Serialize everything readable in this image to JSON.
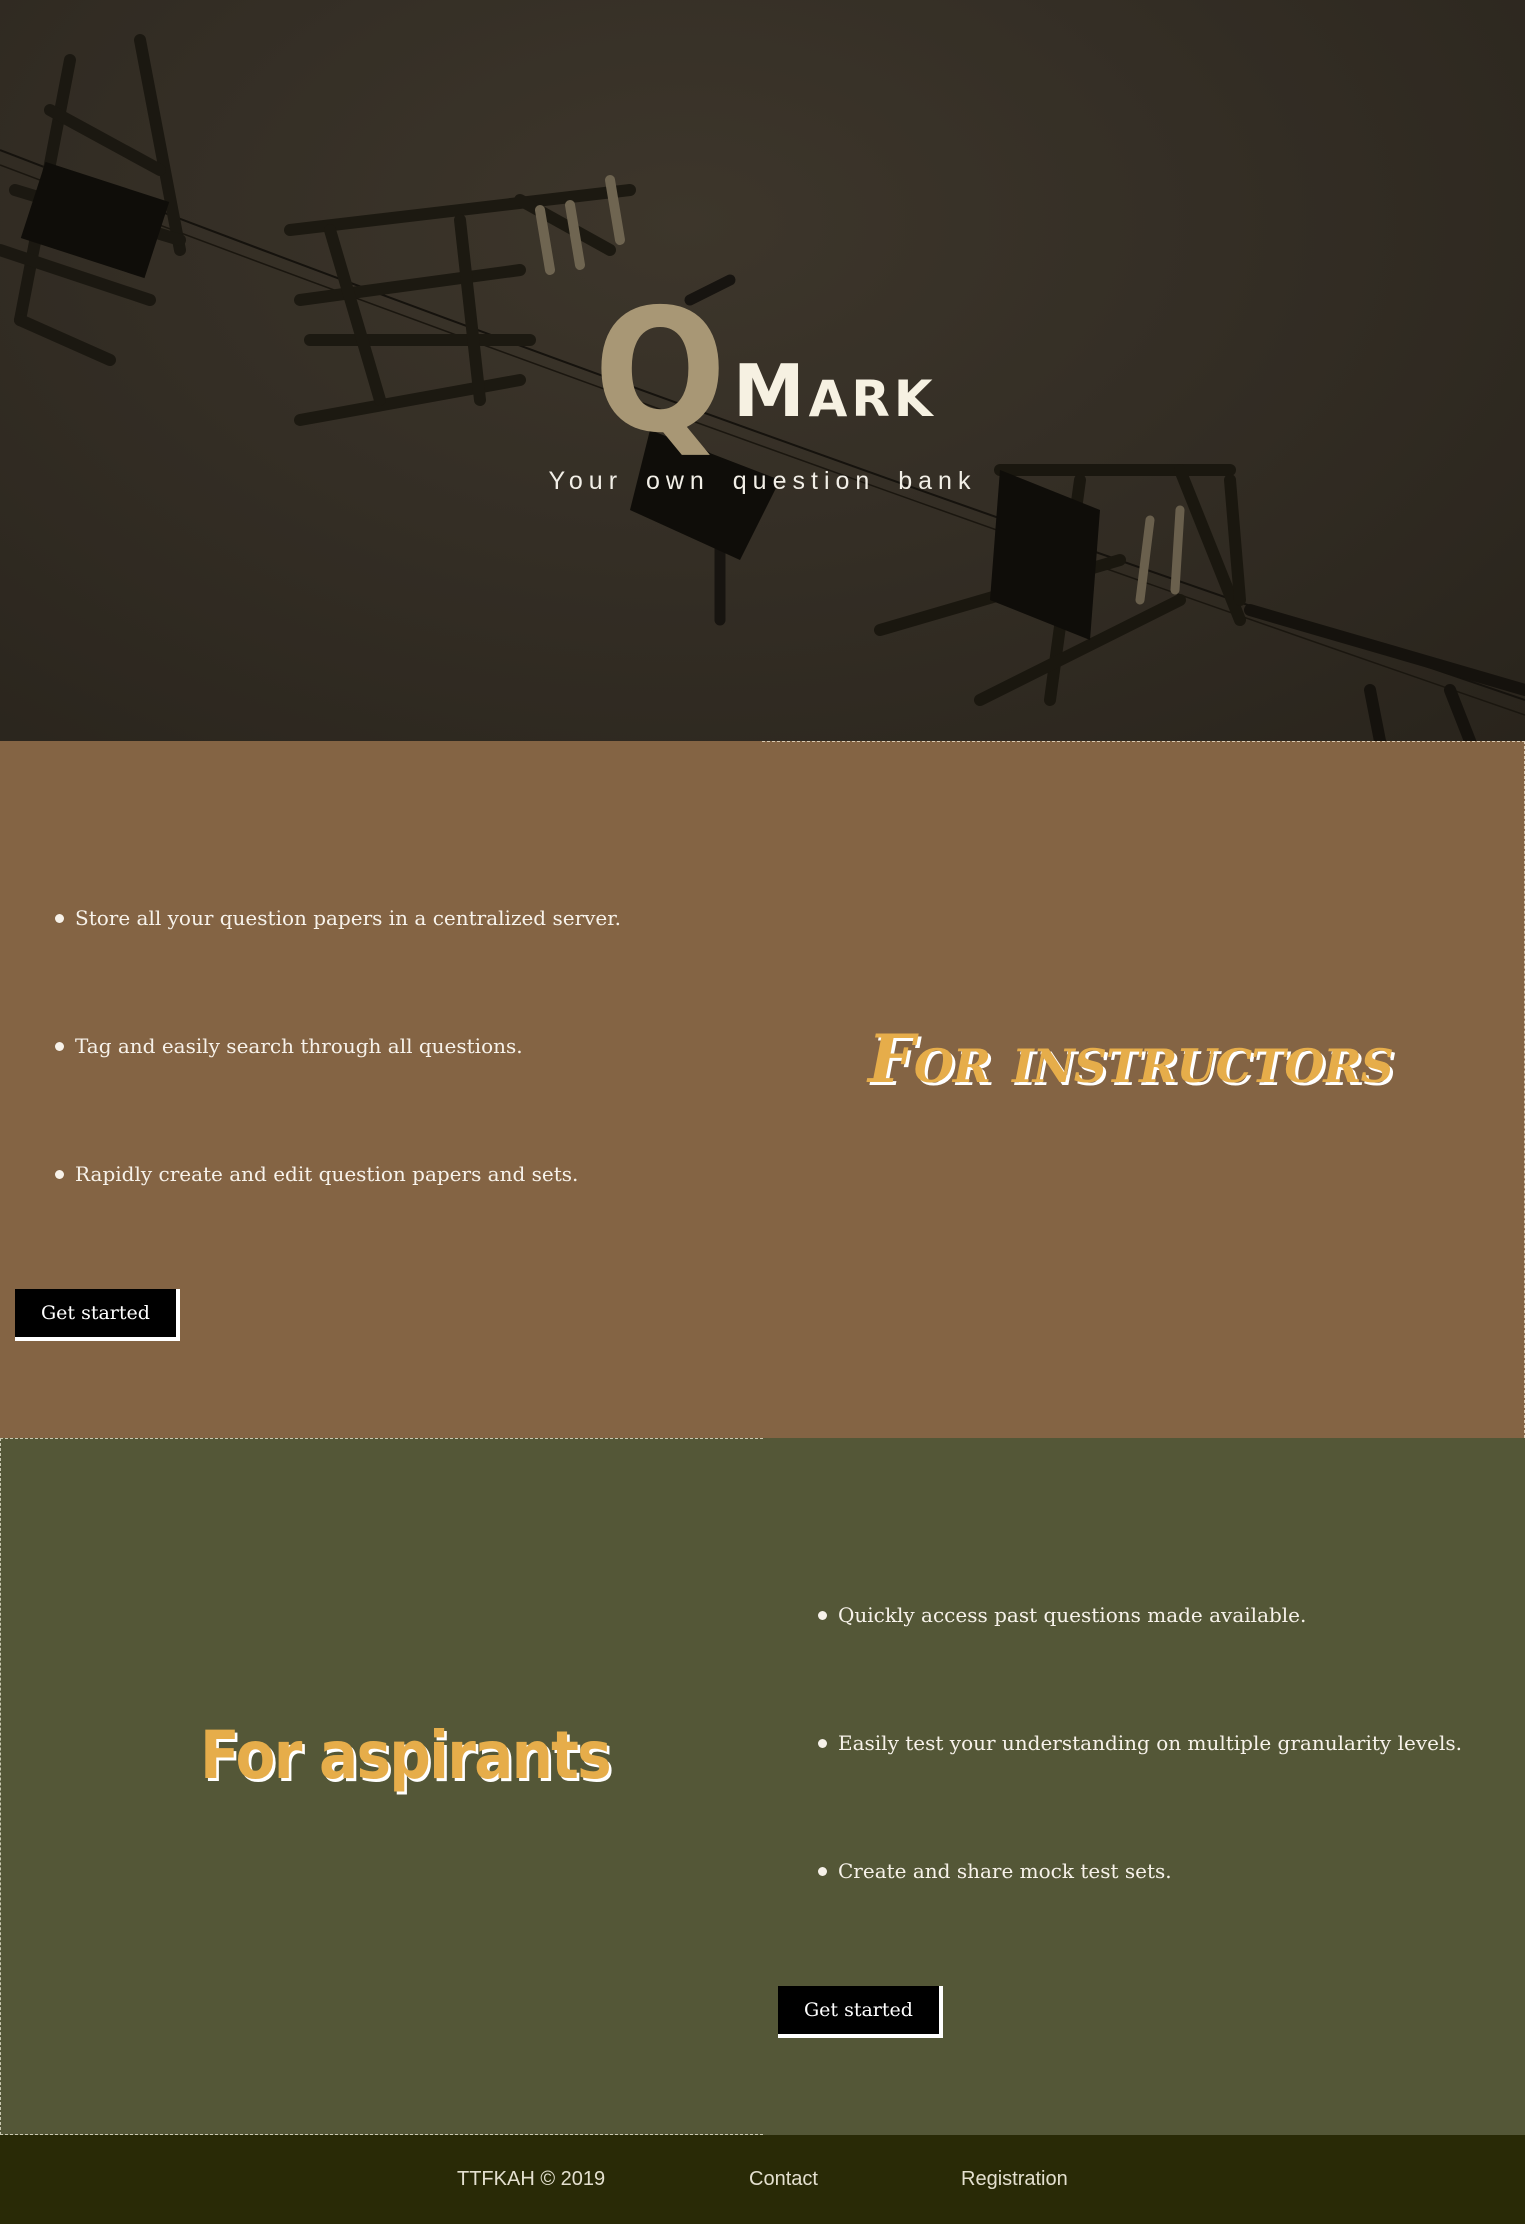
{
  "hero": {
    "brand_initial": "Q",
    "brand_rest": "Mark",
    "tagline": "Your own question bank"
  },
  "instructors": {
    "heading": "For instructors",
    "features": [
      "Store all your question papers in a centralized server.",
      "Tag and easily search through all questions.",
      "Rapidly create and edit question papers and sets."
    ],
    "cta_label": "Get started"
  },
  "aspirants": {
    "heading": "For aspirants",
    "features": [
      "Quickly access past questions made available.",
      "Easily test your understanding on multiple granularity levels.",
      "Create and share mock test sets."
    ],
    "cta_label": "Get started"
  },
  "footer": {
    "copyright": "TTFKAH © 2019",
    "contact_label": "Contact",
    "registration_label": "Registration"
  },
  "colors": {
    "instructors_bg": "#846444",
    "aspirants_bg": "#545737",
    "heading_accent": "#e6ad4a",
    "footer_bg": "#292a06",
    "brand_q": "#a89775"
  }
}
